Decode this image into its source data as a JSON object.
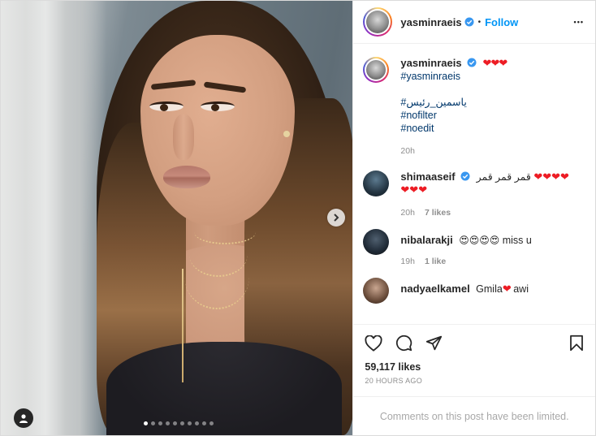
{
  "post": {
    "image_alt": "Portrait photo of a woman with long wavy hair",
    "carousel": {
      "count": 10,
      "active_index": 0
    }
  },
  "header": {
    "username": "yasminraeis",
    "separator": "•",
    "follow_label": "Follow",
    "more_label": "•••"
  },
  "caption": {
    "username": "yasminraeis",
    "hearts": "❤❤❤",
    "hashtags": [
      "#yasminraeis",
      "#ياسمين_رئيس",
      "#nofilter",
      "#noedit"
    ],
    "time": "20h"
  },
  "comments": [
    {
      "username": "shimaaseif",
      "verified": true,
      "text": "قمر قمر قمر",
      "hearts_after": "❤❤❤❤",
      "hearts_line2": "❤❤❤",
      "time": "20h",
      "likes": "7 likes"
    },
    {
      "username": "nibalarakji",
      "verified": false,
      "emojis": "😍😍😍😍",
      "text": "miss u",
      "time": "19h",
      "likes": "1 like"
    },
    {
      "username": "nadyaelkamel",
      "verified": false,
      "text_before": "Gmila",
      "heart": "❤",
      "text_after": "awi"
    }
  ],
  "likes_count": "59,117 likes",
  "time_ago": "20 HOURS AGO",
  "comments_limited": "Comments on this post have been limited.",
  "colors": {
    "link": "#0095f6",
    "hashtag": "#00376b",
    "muted": "#8e8e8e",
    "heart": "#ed1c24"
  }
}
